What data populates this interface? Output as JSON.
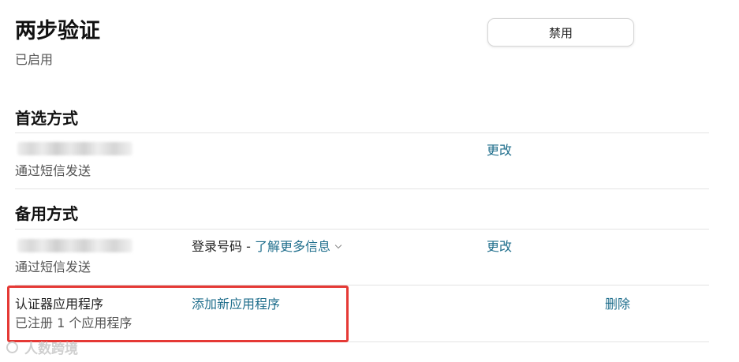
{
  "header": {
    "title": "两步验证",
    "status": "已启用",
    "disable_label": "禁用"
  },
  "preferred": {
    "title": "首选方式",
    "method": "通过短信发送",
    "change_label": "更改"
  },
  "backup": {
    "title": "备用方式",
    "method": "通过短信发送",
    "login_number_label": "登录号码 - ",
    "learn_more_label": "了解更多信息",
    "change_label": "更改"
  },
  "authenticator": {
    "title": "认证器应用程序",
    "registered": "已注册 1 个应用程序",
    "add_label": "添加新应用程序",
    "delete_label": "删除"
  },
  "watermark": {
    "text": "人数跨境"
  },
  "colors": {
    "link": "#1f6e8c",
    "highlight": "#e53935"
  }
}
